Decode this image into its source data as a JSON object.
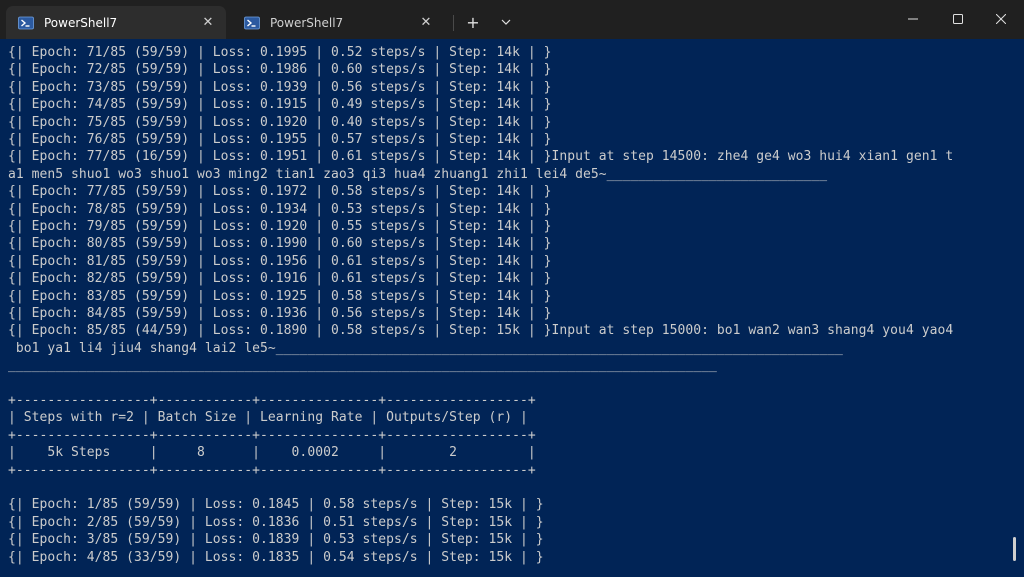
{
  "tabs": [
    {
      "label": "PowerShell7",
      "active": true
    },
    {
      "label": "PowerShell7",
      "active": false
    }
  ],
  "tab_close_glyph": "✕",
  "new_tab_glyph": "+",
  "dropdown_glyph": "⌄",
  "colors": {
    "terminal_background": "#012456",
    "terminal_text": "#cccccc",
    "titlebar_background": "#202020",
    "active_tab_background": "#2d2d2d"
  },
  "icons": {
    "tab_icon": "powershell-icon",
    "minimize": "minimize-icon",
    "maximize": "maximize-icon",
    "close": "close-icon"
  },
  "terminal_lines": [
    "{| Epoch: 71/85 (59/59) | Loss: 0.1995 | 0.52 steps/s | Step: 14k | }",
    "{| Epoch: 72/85 (59/59) | Loss: 0.1986 | 0.60 steps/s | Step: 14k | }",
    "{| Epoch: 73/85 (59/59) | Loss: 0.1939 | 0.56 steps/s | Step: 14k | }",
    "{| Epoch: 74/85 (59/59) | Loss: 0.1915 | 0.49 steps/s | Step: 14k | }",
    "{| Epoch: 75/85 (59/59) | Loss: 0.1920 | 0.40 steps/s | Step: 14k | }",
    "{| Epoch: 76/85 (59/59) | Loss: 0.1955 | 0.57 steps/s | Step: 14k | }",
    "{| Epoch: 77/85 (16/59) | Loss: 0.1951 | 0.61 steps/s | Step: 14k | }Input at step 14500: zhe4 ge4 wo3 hui4 xian1 gen1 t",
    "a1 men5 shuo1 wo3 shuo1 wo3 ming2 tian1 zao3 qi3 hua4 zhuang1 zhi1 lei4 de5~____________________________",
    "{| Epoch: 77/85 (59/59) | Loss: 0.1972 | 0.58 steps/s | Step: 14k | }",
    "{| Epoch: 78/85 (59/59) | Loss: 0.1934 | 0.53 steps/s | Step: 14k | }",
    "{| Epoch: 79/85 (59/59) | Loss: 0.1920 | 0.55 steps/s | Step: 14k | }",
    "{| Epoch: 80/85 (59/59) | Loss: 0.1990 | 0.60 steps/s | Step: 14k | }",
    "{| Epoch: 81/85 (59/59) | Loss: 0.1956 | 0.61 steps/s | Step: 14k | }",
    "{| Epoch: 82/85 (59/59) | Loss: 0.1916 | 0.61 steps/s | Step: 14k | }",
    "{| Epoch: 83/85 (59/59) | Loss: 0.1925 | 0.58 steps/s | Step: 14k | }",
    "{| Epoch: 84/85 (59/59) | Loss: 0.1936 | 0.56 steps/s | Step: 14k | }",
    "{| Epoch: 85/85 (44/59) | Loss: 0.1890 | 0.58 steps/s | Step: 15k | }Input at step 15000: bo1 wan2 wan3 shang4 you4 yao4",
    " bo1 ya1 li4 jiu4 shang4 lai2 le5~________________________________________________________________________",
    "__________________________________________________________________________________________",
    "",
    "+-----------------+------------+---------------+------------------+",
    "| Steps with r=2 | Batch Size | Learning Rate | Outputs/Step (r) |",
    "+-----------------+------------+---------------+------------------+",
    "|    5k Steps     |     8      |    0.0002     |        2         |",
    "+-----------------+------------+---------------+------------------+",
    "",
    "{| Epoch: 1/85 (59/59) | Loss: 0.1845 | 0.58 steps/s | Step: 15k | }",
    "{| Epoch: 2/85 (59/59) | Loss: 0.1836 | 0.51 steps/s | Step: 15k | }",
    "{| Epoch: 3/85 (59/59) | Loss: 0.1839 | 0.53 steps/s | Step: 15k | }",
    "{| Epoch: 4/85 (33/59) | Loss: 0.1835 | 0.54 steps/s | Step: 15k | }"
  ]
}
